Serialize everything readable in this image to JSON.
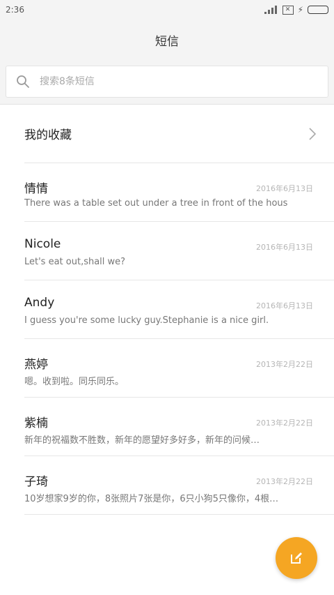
{
  "status": {
    "time": "2:36",
    "battery_level": 1.0,
    "battery_color": "#3fb54a"
  },
  "header": {
    "title": "短信"
  },
  "search": {
    "placeholder": "搜索8条短信"
  },
  "favorites": {
    "label": "我的收藏"
  },
  "conversations": [
    {
      "name": "情情",
      "date": "2016年6月13日",
      "preview": "There was a table set out under a tree in front of the hous"
    },
    {
      "name": "Nicole",
      "date": "2016年6月13日",
      "preview": "Let's eat out,shall we?"
    },
    {
      "name": "Andy",
      "date": "2016年6月13日",
      "preview": "I guess you're some lucky guy.Stephanie is a nice girl."
    },
    {
      "name": "燕婷",
      "date": "2013年2月22日",
      "preview": "嗯。收到啦。同乐同乐。"
    },
    {
      "name": "紫楠",
      "date": "2013年2月22日",
      "preview": "新年的祝福数不胜数，新年的愿望好多好多，新年的问候…"
    },
    {
      "name": "子琦",
      "date": "2013年2月22日",
      "preview": "10岁想家9岁的你，8张照片7张是你，6只小狗5只像你，4根…"
    }
  ],
  "colors": {
    "accent": "#f5a623"
  },
  "icons": {
    "search": "search-icon",
    "chevron": "chevron-right-icon",
    "compose": "compose-icon"
  }
}
